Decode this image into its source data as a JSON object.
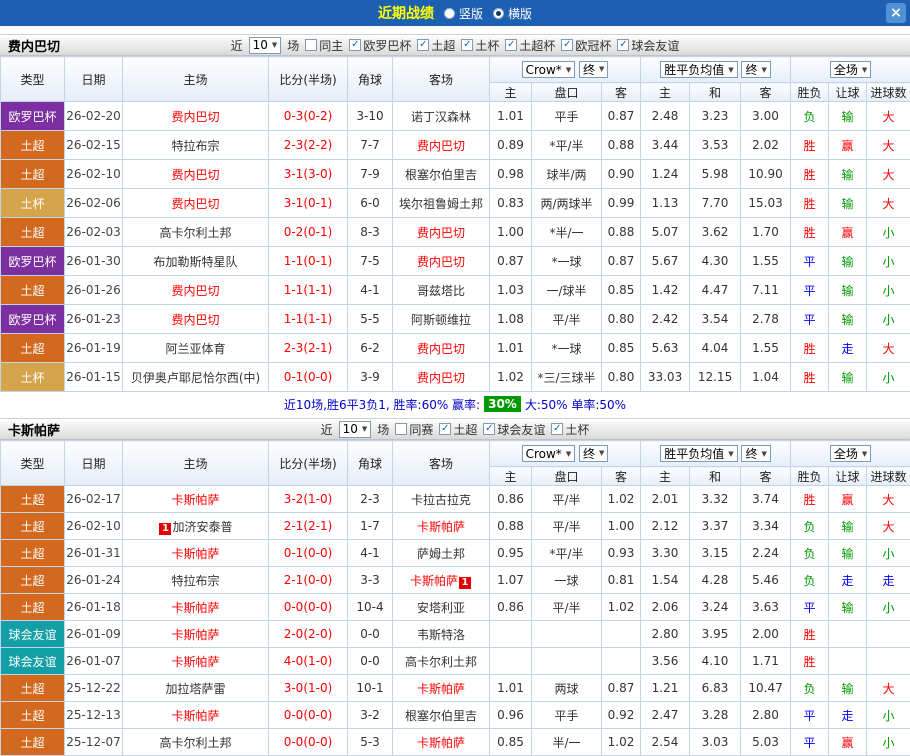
{
  "titlebar": {
    "title": "近期战绩",
    "radio_vertical": "竖版",
    "radio_horizontal": "横版",
    "close": "×"
  },
  "colors": {
    "titlebar_bg": "#1d5fb0",
    "type_europa": "#7c2fa0",
    "type_superlig": "#d2691e",
    "type_cup": "#d6a54b",
    "type_friendly": "#12a0a6",
    "result_win": "#ff0000",
    "result_lose": "#009900",
    "result_draw": "#0000ff",
    "focus_team": "#ff0000",
    "win_rate_badge_bg": "#009900"
  },
  "sections": [
    {
      "team": "费内巴切",
      "filter": {
        "prefix": "近",
        "count": "10",
        "suffix": "场",
        "options": [
          {
            "label": "同主",
            "checked": false
          },
          {
            "label": "欧罗巴杯",
            "checked": true
          },
          {
            "label": "土超",
            "checked": true
          },
          {
            "label": "土杯",
            "checked": true
          },
          {
            "label": "土超杯",
            "checked": true
          },
          {
            "label": "欧冠杯",
            "checked": true
          },
          {
            "label": "球会友谊",
            "checked": true
          }
        ]
      },
      "selects": {
        "odds": "Crow*",
        "final1": "终",
        "avg": "胜平负均值",
        "final2": "终",
        "scope": "全场"
      },
      "columns": {
        "type": "类型",
        "date": "日期",
        "home": "主场",
        "score": "比分(半场)",
        "corners": "角球",
        "away": "客场",
        "ah_home": "主",
        "ah_line": "盘口",
        "ah_away": "客",
        "eu_home": "主",
        "eu_draw": "和",
        "eu_away": "客",
        "res_wdl": "胜负",
        "res_ah": "让球",
        "res_goals": "进球数"
      },
      "rows": [
        {
          "type": "欧罗巴杯",
          "date": "26-02-20",
          "home": "费内巴切",
          "home_focus": true,
          "home_badge": "",
          "home_badge_pos": "",
          "score": "0-3(0-2)",
          "corners": "3-10",
          "away": "诺丁汉森林",
          "away_focus": false,
          "away_badge": "",
          "away_badge_pos": "",
          "ah": [
            "1.01",
            "平手",
            "0.87"
          ],
          "eu": [
            "2.48",
            "3.23",
            "3.00"
          ],
          "results": [
            "负",
            "输",
            "大"
          ],
          "result_colors": [
            "green",
            "green",
            "red"
          ]
        },
        {
          "type": "土超",
          "date": "26-02-15",
          "home": "特拉布宗",
          "home_focus": false,
          "home_badge": "",
          "home_badge_pos": "",
          "score": "2-3(2-2)",
          "corners": "7-7",
          "away": "费内巴切",
          "away_focus": true,
          "away_badge": "",
          "away_badge_pos": "",
          "ah": [
            "0.89",
            "*平/半",
            "0.88"
          ],
          "eu": [
            "3.44",
            "3.53",
            "2.02"
          ],
          "results": [
            "胜",
            "赢",
            "大"
          ],
          "result_colors": [
            "red",
            "red",
            "red"
          ]
        },
        {
          "type": "土超",
          "date": "26-02-10",
          "home": "费内巴切",
          "home_focus": true,
          "home_badge": "",
          "home_badge_pos": "",
          "score": "3-1(3-0)",
          "corners": "7-9",
          "away": "根塞尔伯里吉",
          "away_focus": false,
          "away_badge": "",
          "away_badge_pos": "",
          "ah": [
            "0.98",
            "球半/两",
            "0.90"
          ],
          "eu": [
            "1.24",
            "5.98",
            "10.90"
          ],
          "results": [
            "胜",
            "输",
            "大"
          ],
          "result_colors": [
            "red",
            "green",
            "red"
          ]
        },
        {
          "type": "土杯",
          "date": "26-02-06",
          "home": "费内巴切",
          "home_focus": true,
          "home_badge": "",
          "home_badge_pos": "",
          "score": "3-1(0-1)",
          "corners": "6-0",
          "away": "埃尔祖鲁姆土邦",
          "away_focus": false,
          "away_badge": "",
          "away_badge_pos": "",
          "ah": [
            "0.83",
            "两/两球半",
            "0.99"
          ],
          "eu": [
            "1.13",
            "7.70",
            "15.03"
          ],
          "results": [
            "胜",
            "输",
            "大"
          ],
          "result_colors": [
            "red",
            "green",
            "red"
          ]
        },
        {
          "type": "土超",
          "date": "26-02-03",
          "home": "高卡尔利土邦",
          "home_focus": false,
          "home_badge": "",
          "home_badge_pos": "",
          "score": "0-2(0-1)",
          "corners": "8-3",
          "away": "费内巴切",
          "away_focus": true,
          "away_badge": "",
          "away_badge_pos": "",
          "ah": [
            "1.00",
            "*半/一",
            "0.88"
          ],
          "eu": [
            "5.07",
            "3.62",
            "1.70"
          ],
          "results": [
            "胜",
            "赢",
            "小"
          ],
          "result_colors": [
            "red",
            "red",
            "green"
          ]
        },
        {
          "type": "欧罗巴杯",
          "date": "26-01-30",
          "home": "布加勒斯特星队",
          "home_focus": false,
          "home_badge": "",
          "home_badge_pos": "",
          "score": "1-1(0-1)",
          "corners": "7-5",
          "away": "费内巴切",
          "away_focus": true,
          "away_badge": "",
          "away_badge_pos": "",
          "ah": [
            "0.87",
            "*一球",
            "0.87"
          ],
          "eu": [
            "5.67",
            "4.30",
            "1.55"
          ],
          "results": [
            "平",
            "输",
            "小"
          ],
          "result_colors": [
            "blue",
            "green",
            "green"
          ]
        },
        {
          "type": "土超",
          "date": "26-01-26",
          "home": "费内巴切",
          "home_focus": true,
          "home_badge": "",
          "home_badge_pos": "",
          "score": "1-1(1-1)",
          "corners": "4-1",
          "away": "哥兹塔比",
          "away_focus": false,
          "away_badge": "",
          "away_badge_pos": "",
          "ah": [
            "1.03",
            "一/球半",
            "0.85"
          ],
          "eu": [
            "1.42",
            "4.47",
            "7.11"
          ],
          "results": [
            "平",
            "输",
            "小"
          ],
          "result_colors": [
            "blue",
            "green",
            "green"
          ]
        },
        {
          "type": "欧罗巴杯",
          "date": "26-01-23",
          "home": "费内巴切",
          "home_focus": true,
          "home_badge": "",
          "home_badge_pos": "",
          "score": "1-1(1-1)",
          "corners": "5-5",
          "away": "阿斯顿维拉",
          "away_focus": false,
          "away_badge": "",
          "away_badge_pos": "",
          "ah": [
            "1.08",
            "平/半",
            "0.80"
          ],
          "eu": [
            "2.42",
            "3.54",
            "2.78"
          ],
          "results": [
            "平",
            "输",
            "小"
          ],
          "result_colors": [
            "blue",
            "green",
            "green"
          ]
        },
        {
          "type": "土超",
          "date": "26-01-19",
          "home": "阿兰亚体育",
          "home_focus": false,
          "home_badge": "",
          "home_badge_pos": "",
          "score": "2-3(2-1)",
          "corners": "6-2",
          "away": "费内巴切",
          "away_focus": true,
          "away_badge": "",
          "away_badge_pos": "",
          "ah": [
            "1.01",
            "*一球",
            "0.85"
          ],
          "eu": [
            "5.63",
            "4.04",
            "1.55"
          ],
          "results": [
            "胜",
            "走",
            "大"
          ],
          "result_colors": [
            "red",
            "blue",
            "red"
          ]
        },
        {
          "type": "土杯",
          "date": "26-01-15",
          "home": "贝伊奥卢耶尼恰尔西(中)",
          "home_focus": false,
          "home_badge": "",
          "home_badge_pos": "",
          "score": "0-1(0-0)",
          "corners": "3-9",
          "away": "费内巴切",
          "away_focus": true,
          "away_badge": "",
          "away_badge_pos": "",
          "ah": [
            "1.02",
            "*三/三球半",
            "0.80"
          ],
          "eu": [
            "33.03",
            "12.15",
            "1.04"
          ],
          "results": [
            "胜",
            "输",
            "小"
          ],
          "result_colors": [
            "red",
            "green",
            "green"
          ]
        }
      ],
      "summary": {
        "pre": "近10场,胜6平3负1, 胜率:60%  赢率:",
        "badge": "30%",
        "post": "大:50%  单率:50%"
      }
    },
    {
      "team": "卡斯帕萨",
      "filter": {
        "prefix": "近",
        "count": "10",
        "suffix": "场",
        "options": [
          {
            "label": "同赛",
            "checked": false
          },
          {
            "label": "土超",
            "checked": true
          },
          {
            "label": "球会友谊",
            "checked": true
          },
          {
            "label": "土杯",
            "checked": true
          }
        ]
      },
      "selects": {
        "odds": "Crow*",
        "final1": "终",
        "avg": "胜平负均值",
        "final2": "终",
        "scope": "全场"
      },
      "columns": {
        "type": "类型",
        "date": "日期",
        "home": "主场",
        "score": "比分(半场)",
        "corners": "角球",
        "away": "客场",
        "ah_home": "主",
        "ah_line": "盘口",
        "ah_away": "客",
        "eu_home": "主",
        "eu_draw": "和",
        "eu_away": "客",
        "res_wdl": "胜负",
        "res_ah": "让球",
        "res_goals": "进球数"
      },
      "rows": [
        {
          "type": "土超",
          "date": "26-02-17",
          "home": "卡斯帕萨",
          "home_focus": true,
          "home_badge": "",
          "home_badge_pos": "",
          "score": "3-2(1-0)",
          "corners": "2-3",
          "away": "卡拉古拉克",
          "away_focus": false,
          "away_badge": "",
          "away_badge_pos": "",
          "ah": [
            "0.86",
            "平/半",
            "1.02"
          ],
          "eu": [
            "2.01",
            "3.32",
            "3.74"
          ],
          "results": [
            "胜",
            "赢",
            "大"
          ],
          "result_colors": [
            "red",
            "red",
            "red"
          ]
        },
        {
          "type": "土超",
          "date": "26-02-10",
          "home": "加济安泰普",
          "home_focus": false,
          "home_badge": "1",
          "home_badge_pos": "left",
          "score": "2-1(2-1)",
          "corners": "1-7",
          "away": "卡斯帕萨",
          "away_focus": true,
          "away_badge": "",
          "away_badge_pos": "",
          "ah": [
            "0.88",
            "平/半",
            "1.00"
          ],
          "eu": [
            "2.12",
            "3.37",
            "3.34"
          ],
          "results": [
            "负",
            "输",
            "大"
          ],
          "result_colors": [
            "green",
            "green",
            "red"
          ]
        },
        {
          "type": "土超",
          "date": "26-01-31",
          "home": "卡斯帕萨",
          "home_focus": true,
          "home_badge": "",
          "home_badge_pos": "",
          "score": "0-1(0-0)",
          "corners": "4-1",
          "away": "萨姆土邦",
          "away_focus": false,
          "away_badge": "",
          "away_badge_pos": "",
          "ah": [
            "0.95",
            "*平/半",
            "0.93"
          ],
          "eu": [
            "3.30",
            "3.15",
            "2.24"
          ],
          "results": [
            "负",
            "输",
            "小"
          ],
          "result_colors": [
            "green",
            "green",
            "green"
          ]
        },
        {
          "type": "土超",
          "date": "26-01-24",
          "home": "特拉布宗",
          "home_focus": false,
          "home_badge": "",
          "home_badge_pos": "",
          "score": "2-1(0-0)",
          "corners": "3-3",
          "away": "卡斯帕萨",
          "away_focus": true,
          "away_badge": "1",
          "away_badge_pos": "right",
          "ah": [
            "1.07",
            "一球",
            "0.81"
          ],
          "eu": [
            "1.54",
            "4.28",
            "5.46"
          ],
          "results": [
            "负",
            "走",
            "走"
          ],
          "result_colors": [
            "green",
            "blue",
            "blue"
          ]
        },
        {
          "type": "土超",
          "date": "26-01-18",
          "home": "卡斯帕萨",
          "home_focus": true,
          "home_badge": "",
          "home_badge_pos": "",
          "score": "0-0(0-0)",
          "corners": "10-4",
          "away": "安塔利亚",
          "away_focus": false,
          "away_badge": "",
          "away_badge_pos": "",
          "ah": [
            "0.86",
            "平/半",
            "1.02"
          ],
          "eu": [
            "2.06",
            "3.24",
            "3.63"
          ],
          "results": [
            "平",
            "输",
            "小"
          ],
          "result_colors": [
            "blue",
            "green",
            "green"
          ]
        },
        {
          "type": "球会友谊",
          "date": "26-01-09",
          "home": "卡斯帕萨",
          "home_focus": true,
          "home_badge": "",
          "home_badge_pos": "",
          "score": "2-0(2-0)",
          "corners": "0-0",
          "away": "韦斯特洛",
          "away_focus": false,
          "away_badge": "",
          "away_badge_pos": "",
          "ah": [
            "",
            "",
            ""
          ],
          "eu": [
            "2.80",
            "3.95",
            "2.00"
          ],
          "results": [
            "胜",
            "",
            ""
          ],
          "result_colors": [
            "red",
            "",
            ""
          ]
        },
        {
          "type": "球会友谊",
          "date": "26-01-07",
          "home": "卡斯帕萨",
          "home_focus": true,
          "home_badge": "",
          "home_badge_pos": "",
          "score": "4-0(1-0)",
          "corners": "0-0",
          "away": "高卡尔利土邦",
          "away_focus": false,
          "away_badge": "",
          "away_badge_pos": "",
          "ah": [
            "",
            "",
            ""
          ],
          "eu": [
            "3.56",
            "4.10",
            "1.71"
          ],
          "results": [
            "胜",
            "",
            ""
          ],
          "result_colors": [
            "red",
            "",
            ""
          ]
        },
        {
          "type": "土超",
          "date": "25-12-22",
          "home": "加拉塔萨雷",
          "home_focus": false,
          "home_badge": "",
          "home_badge_pos": "",
          "score": "3-0(1-0)",
          "corners": "10-1",
          "away": "卡斯帕萨",
          "away_focus": true,
          "away_badge": "",
          "away_badge_pos": "",
          "ah": [
            "1.01",
            "两球",
            "0.87"
          ],
          "eu": [
            "1.21",
            "6.83",
            "10.47"
          ],
          "results": [
            "负",
            "输",
            "大"
          ],
          "result_colors": [
            "green",
            "green",
            "red"
          ]
        },
        {
          "type": "土超",
          "date": "25-12-13",
          "home": "卡斯帕萨",
          "home_focus": true,
          "home_badge": "",
          "home_badge_pos": "",
          "score": "0-0(0-0)",
          "corners": "3-2",
          "away": "根塞尔伯里吉",
          "away_focus": false,
          "away_badge": "",
          "away_badge_pos": "",
          "ah": [
            "0.96",
            "平手",
            "0.92"
          ],
          "eu": [
            "2.47",
            "3.28",
            "2.80"
          ],
          "results": [
            "平",
            "走",
            "小"
          ],
          "result_colors": [
            "blue",
            "blue",
            "green"
          ]
        },
        {
          "type": "土超",
          "date": "25-12-07",
          "home": "高卡尔利土邦",
          "home_focus": false,
          "home_badge": "",
          "home_badge_pos": "",
          "score": "0-0(0-0)",
          "corners": "5-3",
          "away": "卡斯帕萨",
          "away_focus": true,
          "away_badge": "",
          "away_badge_pos": "",
          "ah": [
            "0.85",
            "半/一",
            "1.02"
          ],
          "eu": [
            "2.54",
            "3.03",
            "5.03"
          ],
          "results": [
            "平",
            "赢",
            "小"
          ],
          "result_colors": [
            "blue",
            "red",
            "green"
          ]
        }
      ],
      "summary": null
    }
  ]
}
